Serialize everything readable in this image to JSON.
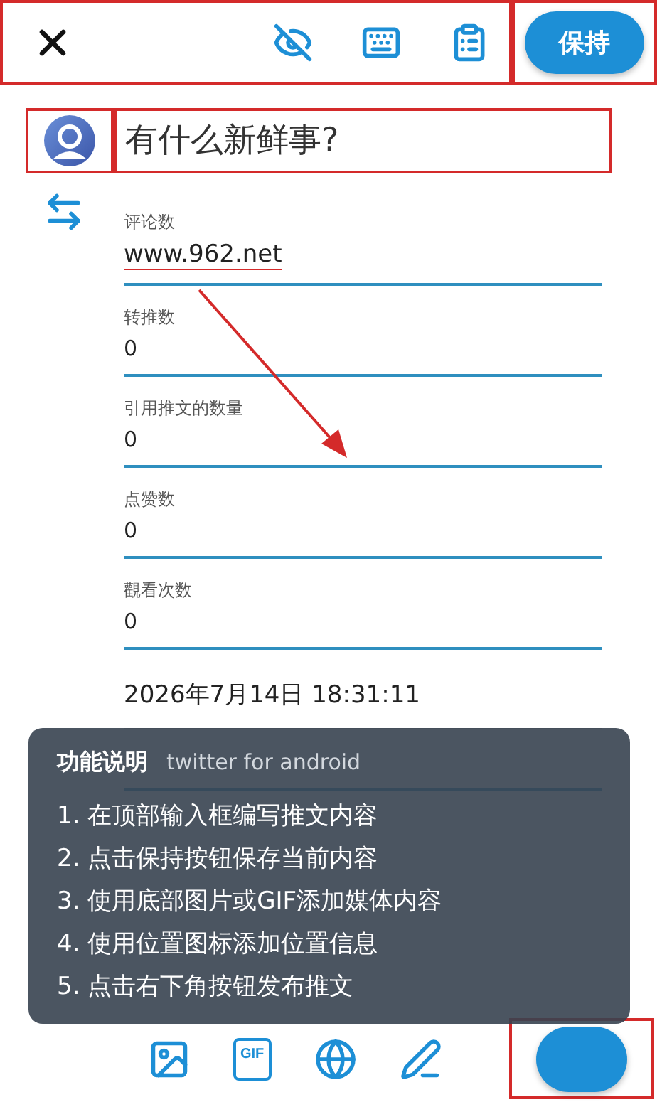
{
  "toolbar": {
    "highlighted": true,
    "icons": [
      {
        "kind": "eye-off"
      },
      {
        "kind": "keyboard"
      },
      {
        "kind": "clipboard"
      }
    ],
    "save_button": {
      "label": "保持",
      "highlighted": true
    }
  },
  "composer": {
    "avatar_highlighted": true,
    "placeholder": "有什么新鲜事?",
    "highlighted": true
  },
  "fields": [
    {
      "kind": "input",
      "label": "评论数",
      "value": "www.962.net",
      "annotated": true
    },
    {
      "kind": "input",
      "label": "转推数",
      "value": "0",
      "annotated": false
    },
    {
      "kind": "input",
      "label": "引用推文的数量",
      "value": "0",
      "annotated": false
    },
    {
      "kind": "input",
      "label": "点赞数",
      "value": "0",
      "annotated": false
    },
    {
      "kind": "input",
      "label": "觀看次数",
      "value": "0",
      "annotated": false
    },
    {
      "kind": "timestamp",
      "value": "2026年7月14日 18:31:11",
      "annotated": false
    },
    {
      "kind": "input",
      "value": "twitter for android",
      "annotated": false
    }
  ],
  "help_panel": {
    "title": "功能说明",
    "items": [
      "1. 在顶部输入框编写推文内容",
      "2. 点击保持按钮保存当前内容",
      "3. 使用底部图片或GIF添加媒体内容",
      "4. 使用位置图标添加位置信息",
      "5. 点击右下角按钮发布推文"
    ]
  },
  "bottom_bar": {
    "tools": [
      {
        "kind": "image"
      },
      {
        "kind": "gif",
        "label": "GIF"
      },
      {
        "kind": "globe"
      },
      {
        "kind": "pen"
      }
    ],
    "publish_button": {
      "highlighted": true
    }
  }
}
